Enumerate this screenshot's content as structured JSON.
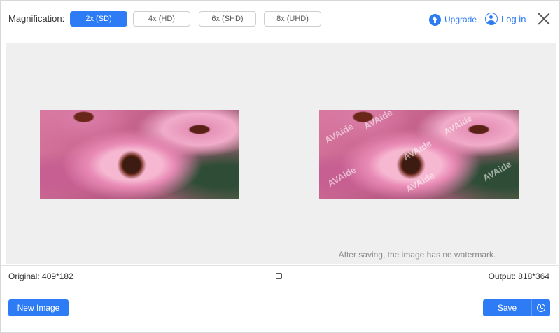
{
  "toolbar": {
    "magnification_label": "Magnification:",
    "options": [
      {
        "label": "2x (SD)",
        "selected": true
      },
      {
        "label": "4x (HD)",
        "selected": false
      },
      {
        "label": "6x (SHD)",
        "selected": false
      },
      {
        "label": "8x (UHD)",
        "selected": false
      }
    ],
    "upgrade_label": "Upgrade",
    "login_label": "Log in",
    "icons": {
      "upgrade": "upgrade-arrow-icon",
      "login": "user-icon",
      "close": "close-icon"
    }
  },
  "preview": {
    "watermark_text": "AVAide",
    "notice": "After saving, the image has no watermark."
  },
  "info": {
    "original": "Original: 409*182",
    "output": "Output: 818*364"
  },
  "footer": {
    "new_image_label": "New Image",
    "save_label": "Save"
  },
  "colors": {
    "accent": "#2d7cf6",
    "preview_bg": "#efefef"
  }
}
